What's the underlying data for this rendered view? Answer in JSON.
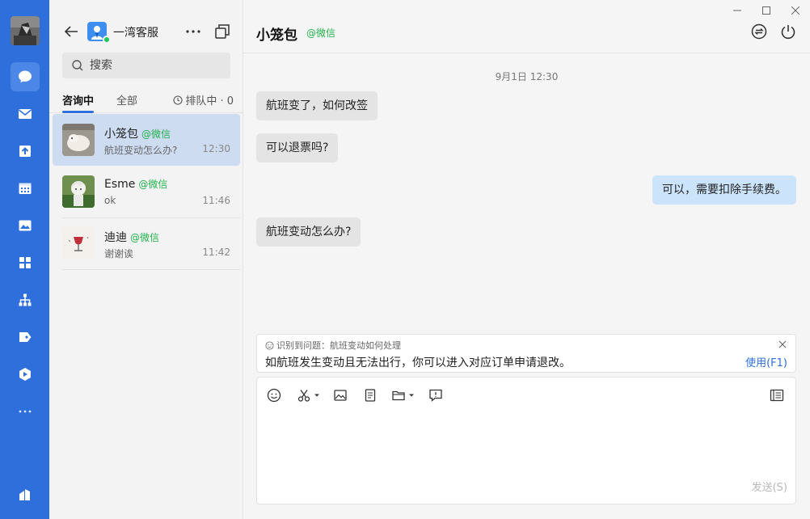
{
  "sidebar": {
    "nav": [
      {
        "icon": "chat-icon",
        "active": true
      },
      {
        "icon": "mail-icon",
        "active": false
      },
      {
        "icon": "upload-icon",
        "active": false
      },
      {
        "icon": "calendar-icon",
        "active": false
      },
      {
        "icon": "image-icon",
        "active": false
      },
      {
        "icon": "apps-icon",
        "active": false
      },
      {
        "icon": "org-chart-icon",
        "active": false
      },
      {
        "icon": "tag-icon",
        "active": false
      },
      {
        "icon": "hexagon-logo-icon",
        "active": false
      },
      {
        "icon": "more-dots-icon",
        "active": false
      }
    ],
    "bottom_icon": "building-icon"
  },
  "list_header": {
    "agent_name": "一湾客服"
  },
  "search": {
    "placeholder": "搜索"
  },
  "tabs": {
    "items": [
      "咨询中",
      "全部"
    ],
    "active": "咨询中",
    "queue_label": "排队中 · 0"
  },
  "conversations": [
    {
      "name": "小笼包",
      "source": "@微信",
      "preview": "航班变动怎么办?",
      "time": "12:30",
      "active": true
    },
    {
      "name": "Esme",
      "source": "@微信",
      "preview": "ok",
      "time": "11:46",
      "active": false
    },
    {
      "name": "迪迪",
      "source": "@微信",
      "preview": "谢谢诶",
      "time": "11:42",
      "active": false
    }
  ],
  "chat": {
    "title": "小笼包",
    "source": "@微信",
    "timestamp": "9月1日 12:30",
    "messages": [
      {
        "direction": "in",
        "text": "航班变了，如何改签"
      },
      {
        "direction": "in",
        "text": "可以退票吗?"
      },
      {
        "direction": "out",
        "text": "可以，需要扣除手续费。"
      },
      {
        "direction": "in",
        "text": "航班变动怎么办?"
      }
    ]
  },
  "suggestion": {
    "label": "识别到问题：航班变动如何处理",
    "text": "如航班发生变动且无法出行，你可以进入对应订单申请退改。",
    "use_label": "使用(F1)"
  },
  "composer": {
    "send_label": "发送(S)"
  },
  "colors": {
    "rail": "#2e6fdb",
    "accent": "#2e6fdb",
    "wechat_green": "#22b14c",
    "active_row": "#cedcf2",
    "outgoing_bubble": "#cce4fb"
  }
}
